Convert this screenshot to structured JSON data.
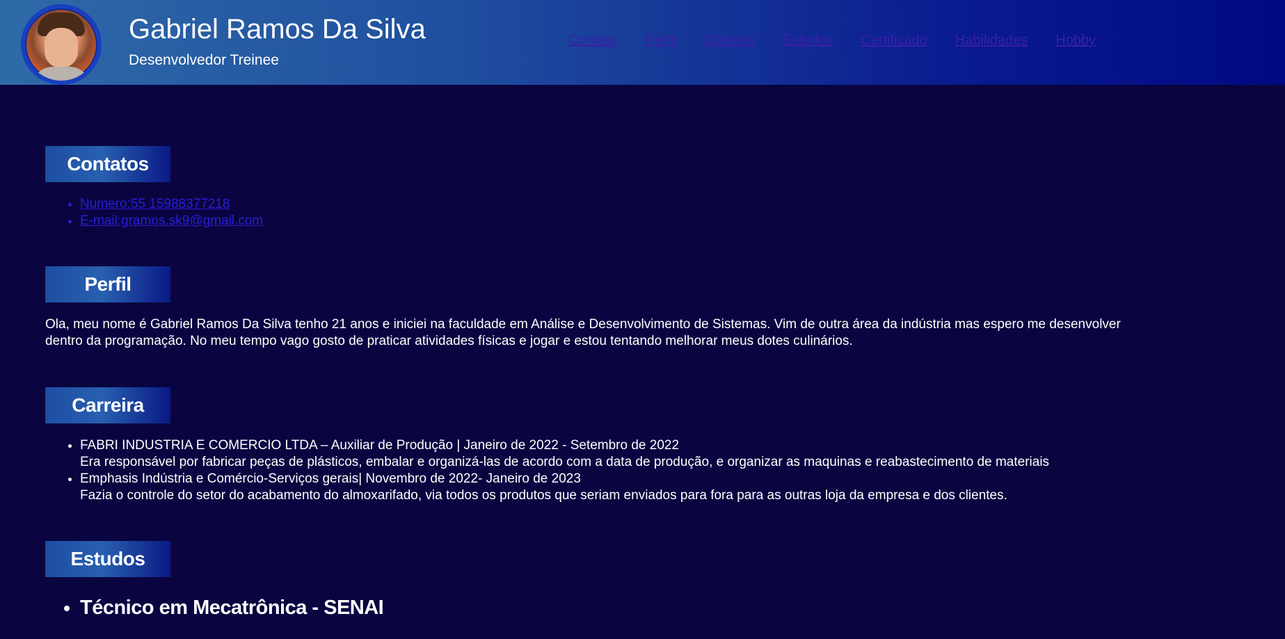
{
  "header": {
    "name": "Gabriel Ramos Da Silva",
    "role": "Desenvolvedor Treinee",
    "avatar": "profile-photo"
  },
  "nav": {
    "items": [
      "Contato",
      "Perfil",
      "Carreira",
      "Estudos",
      "Certificado",
      "Habilidades",
      "Hobby"
    ]
  },
  "contatos": {
    "title": "Contatos",
    "items": [
      "Numero:55 15988377218",
      "E-mail:gramos.sk9@gmail.com"
    ]
  },
  "perfil": {
    "title": "Perfil",
    "text": "Ola, meu nome é Gabriel Ramos Da Silva tenho 21 anos e iniciei na faculdade em Análise e Desenvolvimento de Sistemas. Vim de outra área da indústria mas espero me desenvolver dentro da programação. No meu tempo vago gosto de praticar atividades físicas e jogar e estou tentando melhorar meus dotes culinários."
  },
  "carreira": {
    "title": "Carreira",
    "items": [
      {
        "heading": "FABRI INDUSTRIA E COMERCIO LTDA – Auxiliar de Produção | Janeiro de 2022 - Setembro de 2022",
        "desc": "Era responsável por fabricar peças de plásticos, embalar e organizá-las de acordo com a data de produção, e organizar as maquinas e reabastecimento de materiais"
      },
      {
        "heading": "Emphasis Indústria e Comércio-Serviços gerais| Novembro de 2022- Janeiro de 2023",
        "desc": "Fazia o controle do setor do acabamento do almoxarifado, via todos os produtos que seriam enviados para fora para as outras loja da empresa e dos clientes."
      }
    ]
  },
  "estudos": {
    "title": "Estudos",
    "items": [
      "Técnico em Mecatrônica - SENAI"
    ]
  },
  "colors": {
    "background": "#0a0440",
    "header_gradient_start": "#2f6aa8",
    "header_gradient_end": "#000a82",
    "link": "#2a1ed6",
    "nav_link": "#3a1fa8"
  }
}
